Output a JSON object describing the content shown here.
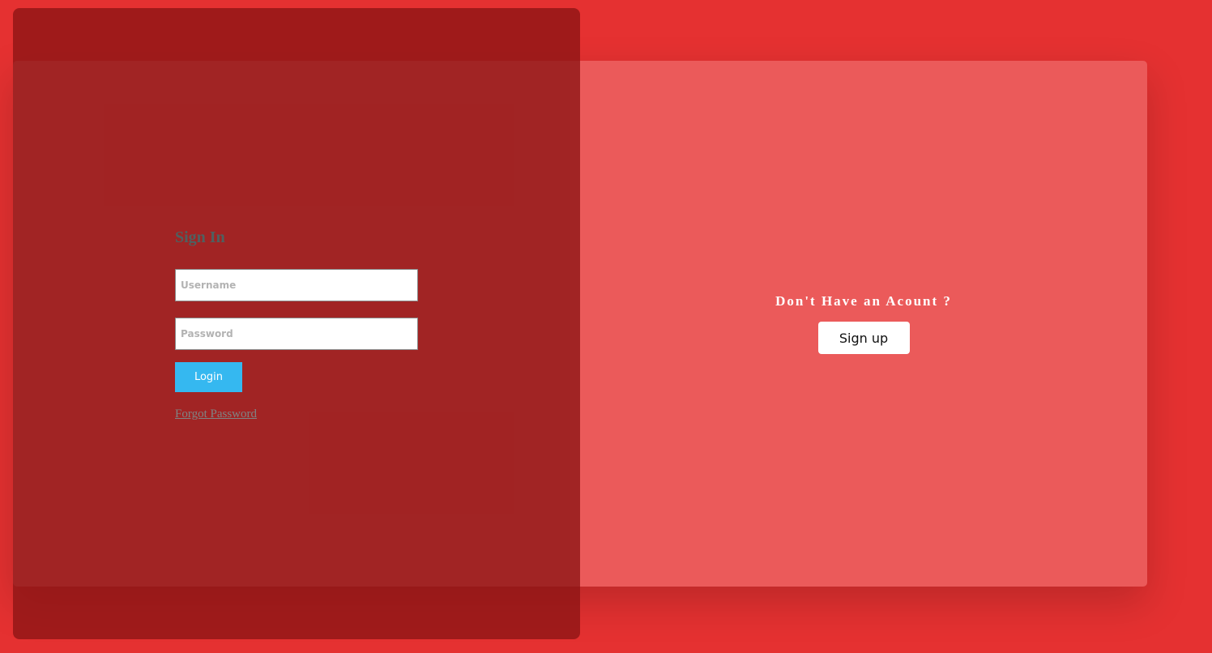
{
  "colors": {
    "background": "#e53131",
    "card": "#eb5a5a",
    "signin_panel": "#9c1f1f",
    "login_button": "#35b8f0",
    "signup_button": "#ffffff"
  },
  "signin": {
    "title": "Sign In",
    "username_placeholder": "Username",
    "password_placeholder": "Password",
    "login_label": "Login",
    "forgot_label": "Forgot Password"
  },
  "signup": {
    "prompt": "Don't Have an Acount ?",
    "button_label": "Sign up"
  }
}
